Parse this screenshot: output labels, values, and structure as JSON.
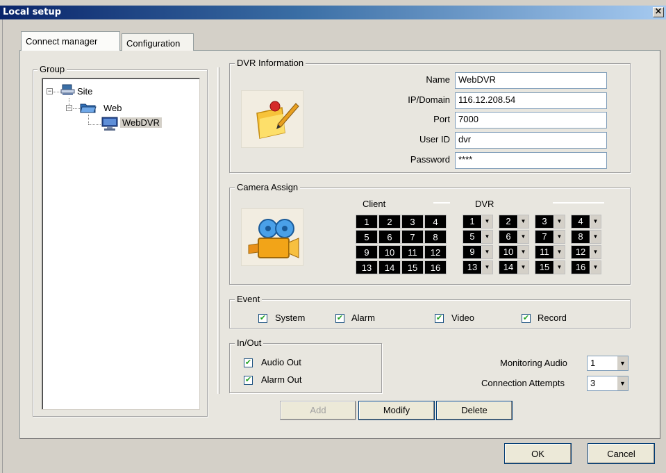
{
  "window": {
    "title": "Local setup",
    "close_glyph": "×"
  },
  "tabs": [
    {
      "label": "Connect manager",
      "active": true
    },
    {
      "label": "Configuration",
      "active": false
    }
  ],
  "group": {
    "legend": "Group",
    "tree": {
      "site": {
        "label": "Site",
        "icon": "site-computer-icon"
      },
      "web": {
        "label": "Web",
        "icon": "folder-icon"
      },
      "dvr": {
        "label": "WebDVR",
        "icon": "dvr-monitor-icon",
        "selected": true
      }
    }
  },
  "dvr_info": {
    "legend": "DVR Information",
    "icon": "edit-document-icon",
    "fields": [
      {
        "label": "Name",
        "value": "WebDVR"
      },
      {
        "label": "IP/Domain",
        "value": "116.12.208.54"
      },
      {
        "label": "Port",
        "value": "7000"
      },
      {
        "label": "User ID",
        "value": "dvr"
      },
      {
        "label": "Password",
        "value": "****"
      }
    ]
  },
  "camera_assign": {
    "legend": "Camera Assign",
    "icon": "film-camera-icon",
    "client_label": "Client",
    "dvr_label": "DVR",
    "client_cells": [
      "1",
      "2",
      "3",
      "4",
      "5",
      "6",
      "7",
      "8",
      "9",
      "10",
      "11",
      "12",
      "13",
      "14",
      "15",
      "16"
    ],
    "dvr_cells": [
      "1",
      "2",
      "3",
      "4",
      "5",
      "6",
      "7",
      "8",
      "9",
      "10",
      "11",
      "12",
      "13",
      "14",
      "15",
      "16"
    ]
  },
  "event": {
    "legend": "Event",
    "items": [
      {
        "label": "System",
        "checked": true
      },
      {
        "label": "Alarm",
        "checked": true
      },
      {
        "label": "Video",
        "checked": true
      },
      {
        "label": "Record",
        "checked": true
      }
    ]
  },
  "in_out": {
    "legend": "In/Out",
    "items": [
      {
        "label": "Audio Out",
        "checked": true
      },
      {
        "label": "Alarm Out",
        "checked": true
      }
    ]
  },
  "monitoring_audio": {
    "label": "Monitoring Audio",
    "value": "1"
  },
  "connection_attempts": {
    "label": "Connection Attempts",
    "value": "3"
  },
  "actions": {
    "add": "Add",
    "modify": "Modify",
    "delete": "Delete"
  },
  "dialog": {
    "ok": "OK",
    "cancel": "Cancel"
  },
  "colors": {
    "title_bar": "#0a246a",
    "panel": "#e8e6df",
    "frame": "#d4d0c8",
    "check": "#21a121"
  }
}
